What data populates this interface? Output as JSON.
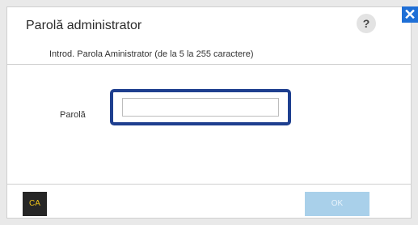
{
  "dialog": {
    "title": "Parolă administrator",
    "help_label": "?",
    "close_label": "✕",
    "instruction": "Introd. Parola Aministrator (de la 5 la 255 caractere)",
    "password_label": "Parolă",
    "password_value": "",
    "ca_label": "CA",
    "ok_label": "OK"
  },
  "colors": {
    "focus_border": "#1e3f8f",
    "close_button": "#1e6fd6",
    "ca_button_bg": "#262626",
    "ca_button_text": "#f0c419",
    "ok_button_bg": "#a9d0ea"
  }
}
